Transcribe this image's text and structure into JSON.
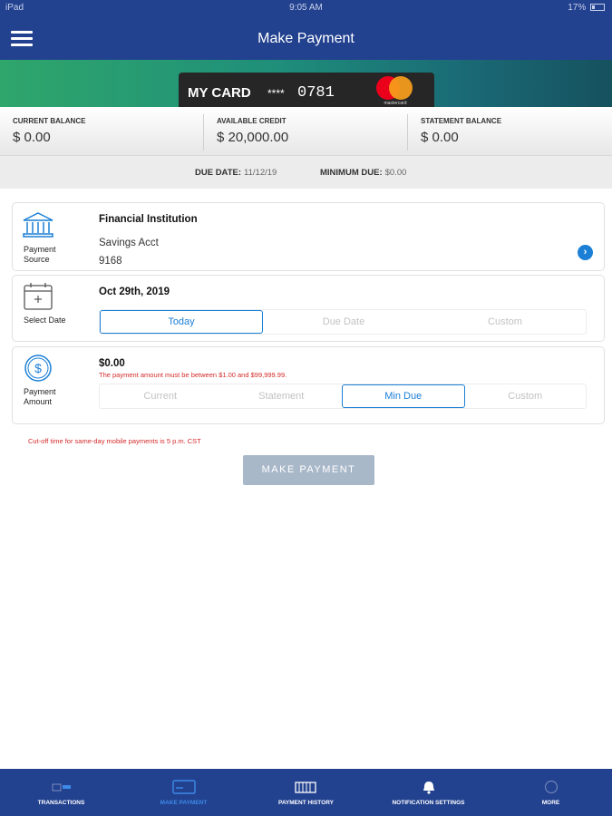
{
  "status_bar": {
    "device": "iPad",
    "time": "9:05 AM",
    "battery": "17%"
  },
  "header": {
    "title": "Make Payment",
    "menu_icon": "hamburger-menu-icon"
  },
  "card": {
    "name": "MY CARD",
    "mask": "****",
    "last_digits": "0781",
    "network": "mastercard",
    "network_logo_text": "mastercard"
  },
  "balances": [
    {
      "label": "CURRENT BALANCE",
      "value": "$ 0.00"
    },
    {
      "label": "AVAILABLE CREDIT",
      "value": "$ 20,000.00"
    },
    {
      "label": "STATEMENT BALANCE",
      "value": "$ 0.00"
    }
  ],
  "due": {
    "due_date_label": "DUE DATE:",
    "due_date": "11/12/19",
    "min_due_label": "MINIMUM DUE:",
    "min_due": "$0.00"
  },
  "payment_source": {
    "icon": "bank-icon",
    "label_line1": "Payment",
    "label_line2": "Source",
    "institution": "Financial Institution",
    "account_type": "Savings Acct",
    "account_number": "9168",
    "chevron": "›"
  },
  "select_date": {
    "icon": "calendar-icon",
    "label": "Select Date",
    "date": "Oct 29th, 2019",
    "options": [
      "Today",
      "Due Date",
      "Custom"
    ],
    "selected": "Today"
  },
  "payment_amount": {
    "icon": "dollar-icon",
    "label_line1": "Payment",
    "label_line2": "Amount",
    "amount": "$0.00",
    "error": "The payment amount must be between $1.00 and $99,999.99.",
    "options": [
      "Current",
      "Statement",
      "Min Due",
      "Custom"
    ],
    "selected": "Min Due"
  },
  "cutoff_note": "Cut-off time for same-day mobile payments is 5 p.m. CST",
  "make_payment_button": "MAKE PAYMENT",
  "tabs": [
    {
      "label": "TRANSACTIONS",
      "icon": "transactions-icon",
      "active": false
    },
    {
      "label": "MAKE PAYMENT",
      "icon": "payment-card-icon",
      "active": true
    },
    {
      "label": "PAYMENT HISTORY",
      "icon": "payment-history-icon",
      "active": false
    },
    {
      "label": "NOTIFICATION SETTINGS",
      "icon": "bell-icon",
      "active": false
    },
    {
      "label": "MORE",
      "icon": "more-icon",
      "active": false
    }
  ],
  "colors": {
    "nav": "#22418f",
    "accent": "#1b7fd6",
    "error": "#d42a2a",
    "button_disabled": "#a9b8c9",
    "tab_active": "#3d8be8"
  }
}
